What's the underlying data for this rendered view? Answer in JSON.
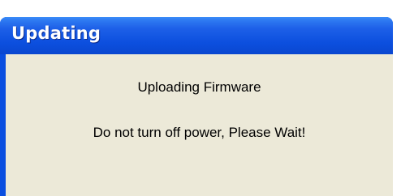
{
  "window": {
    "title": "Updating"
  },
  "content": {
    "heading": "Uploading Firmware",
    "message": "Do not turn off power, Please Wait!"
  },
  "colors": {
    "titlebar": "#0c4fde",
    "client_background": "#ece9d8",
    "title_text": "#ffffff"
  }
}
